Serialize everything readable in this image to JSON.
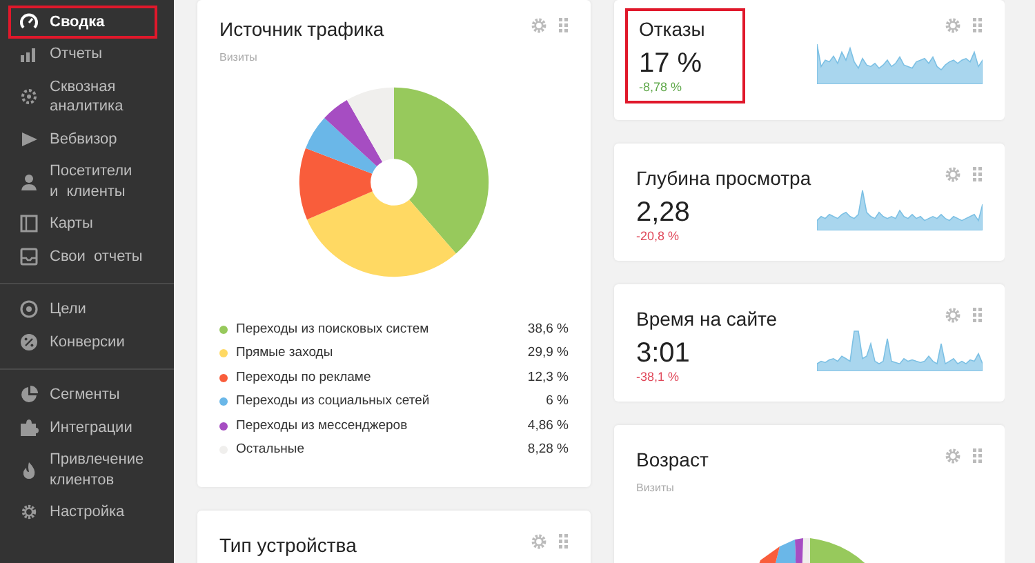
{
  "sidebar": {
    "groups": [
      [
        {
          "label": "Сводка",
          "selected": true,
          "highlighted": true
        },
        {
          "label": "Отчеты",
          "selected": false,
          "highlighted": false
        },
        {
          "label": "Сквозная аналитика",
          "selected": false,
          "highlighted": false
        },
        {
          "label": "Вебвизор",
          "selected": false,
          "highlighted": false
        },
        {
          "label": "Посетители и клиенты",
          "selected": false,
          "highlighted": false
        },
        {
          "label": "Карты",
          "selected": false,
          "highlighted": false
        },
        {
          "label": "Свои отчеты",
          "selected": false,
          "highlighted": false
        }
      ],
      [
        {
          "label": "Цели",
          "selected": false,
          "highlighted": false
        },
        {
          "label": "Конверсии",
          "selected": false,
          "highlighted": false
        }
      ],
      [
        {
          "label": "Сегменты",
          "selected": false,
          "highlighted": false
        },
        {
          "label": "Интеграции",
          "selected": false,
          "highlighted": false
        },
        {
          "label": "Привлечение клиентов",
          "selected": false,
          "highlighted": false
        },
        {
          "label": "Настройка",
          "selected": false,
          "highlighted": false
        }
      ]
    ]
  },
  "traffic_source": {
    "title": "Источник трафика",
    "subtitle": "Визиты",
    "chart_data": {
      "type": "donut",
      "categories": [
        "Переходы из поисковых систем",
        "Прямые заходы",
        "Переходы по рекламе",
        "Переходы из социальных сетей",
        "Переходы из мессенджеров",
        "Остальные"
      ],
      "values": [
        38.6,
        29.9,
        12.3,
        6,
        4.86,
        8.28
      ]
    },
    "legend": [
      {
        "value": "38,6 %",
        "color": "#97c95c"
      },
      {
        "value": "29,9 %",
        "color": "#ffd963"
      },
      {
        "value": "12,3 %",
        "color": "#f95d3b"
      },
      {
        "value": "6 %",
        "color": "#6ab7e8"
      },
      {
        "value": "4,86 %",
        "color": "#a64dc2"
      },
      {
        "value": "8,28 %",
        "color": "#f0efed"
      }
    ]
  },
  "device_type": {
    "title": "Тип устройства"
  },
  "metrics": [
    {
      "title": "Отказы",
      "value": "17 %",
      "delta": "-8,78 %",
      "color": "#5fa84a",
      "highlighted": true
    },
    {
      "title": "Глубина просмотра",
      "value": "2,28",
      "delta": "-20,8 %",
      "color": "#e0485a",
      "highlighted": false
    },
    {
      "title": "Время на сайте",
      "value": "3:01",
      "delta": "-38,1 %",
      "color": "#e0485a",
      "highlighted": false
    }
  ],
  "age": {
    "title": "Возраст",
    "subtitle": "Визиты"
  }
}
